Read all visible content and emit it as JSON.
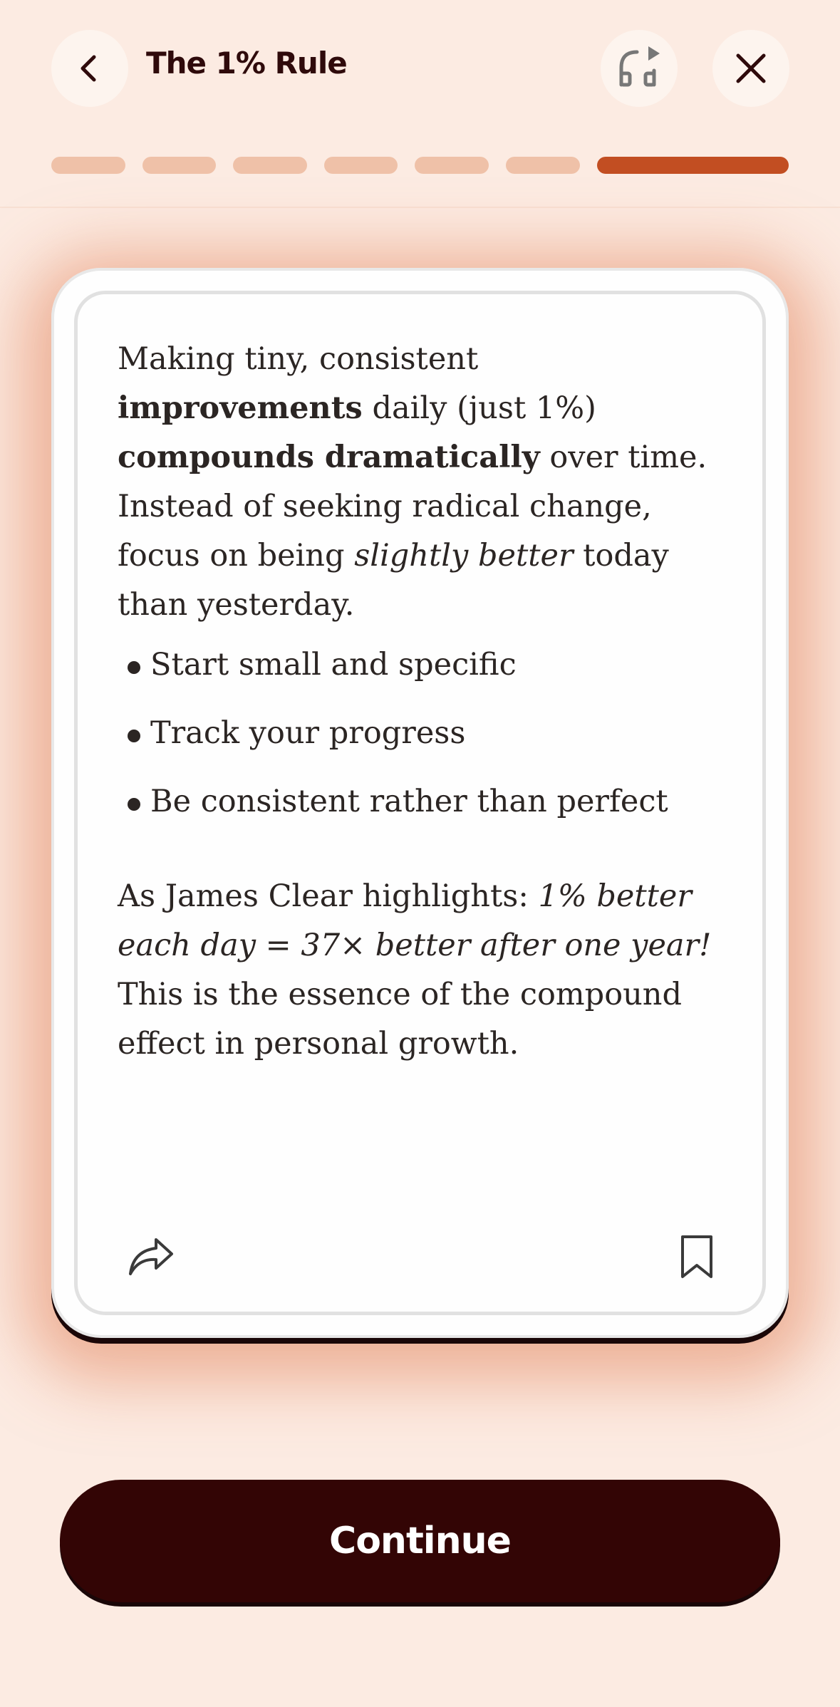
{
  "header": {
    "title": "The 1% Rule",
    "back_icon": "chevron-left-icon",
    "audio_icon": "headphones-play-icon",
    "close_icon": "close-icon"
  },
  "progress": {
    "total_steps": 7,
    "current_step": 7
  },
  "card": {
    "para1": {
      "t1": "Making tiny, consistent ",
      "b1": "improvements",
      "t2": " daily (just 1%) ",
      "b2": "compounds dramatically",
      "t3": " over time. Instead of seeking radical change, focus on being ",
      "i1": "slightly better",
      "t4": " today than yesterday."
    },
    "bullets": [
      "Start small and specific",
      "Track your progress",
      "Be consistent rather than perfect"
    ],
    "para2": {
      "t1": "As James Clear highlights: ",
      "i1": "1% better each day = 37× better after one year!",
      "t2": " This is the essence of the compound effect in personal growth."
    },
    "share_icon": "share-icon",
    "bookmark_icon": "bookmark-icon"
  },
  "footer": {
    "continue_label": "Continue"
  },
  "colors": {
    "background": "#fcebe2",
    "accent": "#c24e22",
    "progress_inactive": "#efc1a8",
    "button": "#330505",
    "title_text": "#2f0a0b"
  }
}
